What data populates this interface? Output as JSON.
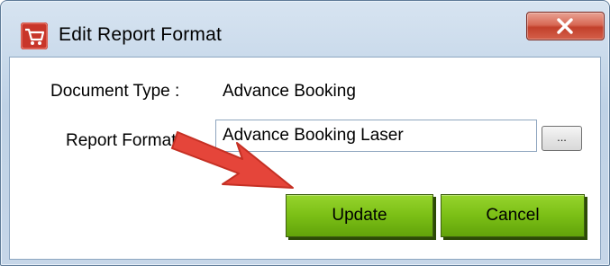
{
  "window": {
    "title": "Edit Report Format",
    "close_glyph": "X"
  },
  "form": {
    "document_type_label": "Document Type :",
    "document_type_value": "Advance Booking",
    "report_format_label": "Report Format :",
    "report_format_value": "Advance Booking Laser",
    "browse_label": "..."
  },
  "buttons": {
    "update": "Update",
    "cancel": "Cancel"
  },
  "colors": {
    "button_green": "#7bbf16",
    "arrow_red": "#e5453a",
    "close_red": "#c2402b"
  },
  "icons": {
    "app": "shopping-cart-icon",
    "annotation": "red-arrow"
  }
}
